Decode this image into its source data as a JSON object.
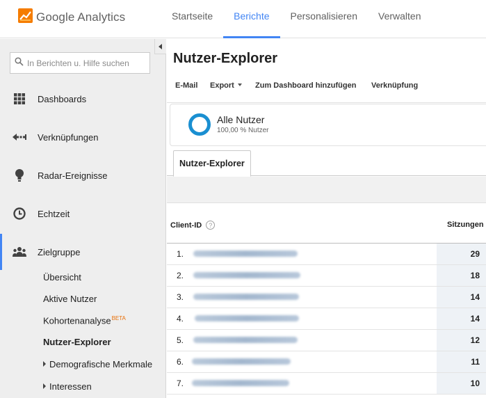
{
  "app": {
    "title": "Google Analytics"
  },
  "topnav": [
    "Startseite",
    "Berichte",
    "Personalisieren",
    "Verwalten"
  ],
  "sidebar": {
    "search_placeholder": "In Berichten u. Hilfe suchen",
    "items": [
      {
        "label": "Dashboards",
        "icon": "dashboard-grid-icon"
      },
      {
        "label": "Verknüpfungen",
        "icon": "shortcut-arrow-icon"
      },
      {
        "label": "Radar-Ereignisse",
        "icon": "lightbulb-icon"
      },
      {
        "label": "Echtzeit",
        "icon": "clock-icon"
      },
      {
        "label": "Zielgruppe",
        "icon": "people-icon",
        "active": true
      }
    ],
    "subitems": {
      "overview": "Übersicht",
      "active_users": "Aktive Nutzer",
      "cohort": "Kohortenanalyse",
      "cohort_badge": "BETA",
      "user_explorer": "Nutzer-Explorer",
      "demographics": "Demografische Merkmale",
      "interests": "Interessen"
    }
  },
  "main": {
    "title": "Nutzer-Explorer",
    "toolbar": {
      "email": "E-Mail",
      "export": "Export",
      "add_dashboard": "Zum Dashboard hinzufügen",
      "shortcut": "Verknüpfung"
    },
    "segment": {
      "name": "Alle Nutzer",
      "percent": "100,00 % Nutzer",
      "color": "#1a8fd1"
    },
    "report_tab": "Nutzer-Explorer",
    "table": {
      "col_client": "Client-ID",
      "col_help": "?",
      "col_sessions": "Sitzungen",
      "rows": [
        {
          "idx": "1.",
          "sessions": "29"
        },
        {
          "idx": "2.",
          "sessions": "18"
        },
        {
          "idx": "3.",
          "sessions": "14"
        },
        {
          "idx": "4.",
          "sessions": "14"
        },
        {
          "idx": "5.",
          "sessions": "12"
        },
        {
          "idx": "6.",
          "sessions": "11"
        },
        {
          "idx": "7.",
          "sessions": "10"
        }
      ]
    }
  }
}
